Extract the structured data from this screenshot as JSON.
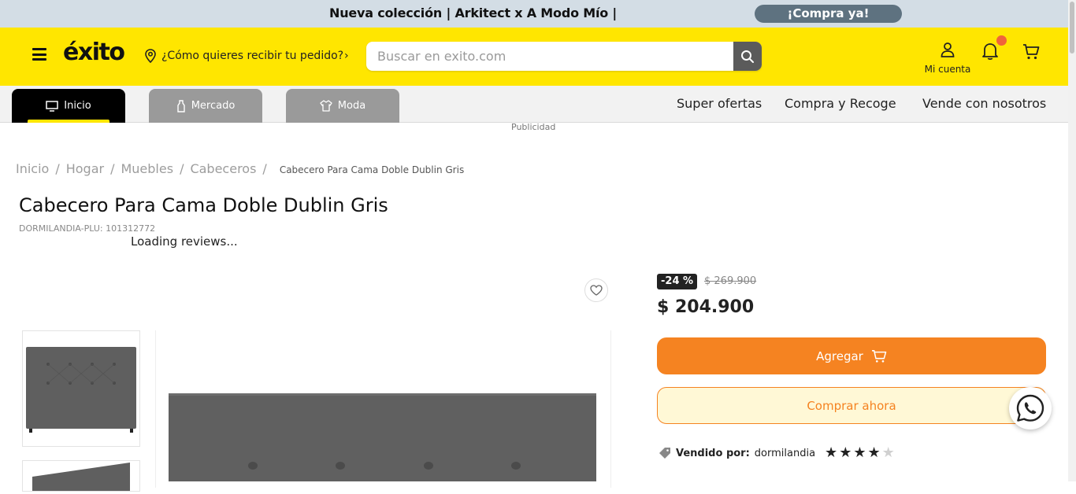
{
  "promo": {
    "text": "Nueva colección | Arkitect x A Modo Mío |",
    "cta": "¡Compra ya!"
  },
  "header": {
    "logo": "éxito",
    "delivery_prompt": "¿Cómo quieres recibir tu pedido?",
    "search_placeholder": "Buscar en exito.com",
    "account_label": "Mi cuenta"
  },
  "nav": {
    "tabs": [
      {
        "label": "Inicio",
        "icon": "monitor-icon"
      },
      {
        "label": "Mercado",
        "icon": "bottle-icon"
      },
      {
        "label": "Moda",
        "icon": "shirt-icon"
      }
    ],
    "links": [
      "Super ofertas",
      "Compra y Recoge",
      "Vende con nosotros"
    ]
  },
  "ad_label": "Publicidad",
  "breadcrumb": {
    "items": [
      "Inicio",
      "Hogar",
      "Muebles",
      "Cabeceros"
    ],
    "current": "Cabecero Para Cama Doble Dublin Gris"
  },
  "product": {
    "title": "Cabecero Para Cama Doble Dublin Gris",
    "sku": "DORMILANDIA-PLU: 101312772",
    "reviews_status": "Loading reviews...",
    "discount": "-24 %",
    "old_price": "$ 269.900",
    "price": "$ 204.900",
    "add_button": "Agregar",
    "buy_now_button": "Comprar ahora",
    "seller_label": "Vendido por:",
    "seller_name": "dormilandia",
    "seller_rating": 4,
    "seller_rating_max": 5
  },
  "colors": {
    "brand_yellow": "#ffe600",
    "accent_orange": "#f58321",
    "promo_bg": "#d3dde5",
    "promo_button": "#5e7280",
    "notification_dot": "#f0643a"
  }
}
